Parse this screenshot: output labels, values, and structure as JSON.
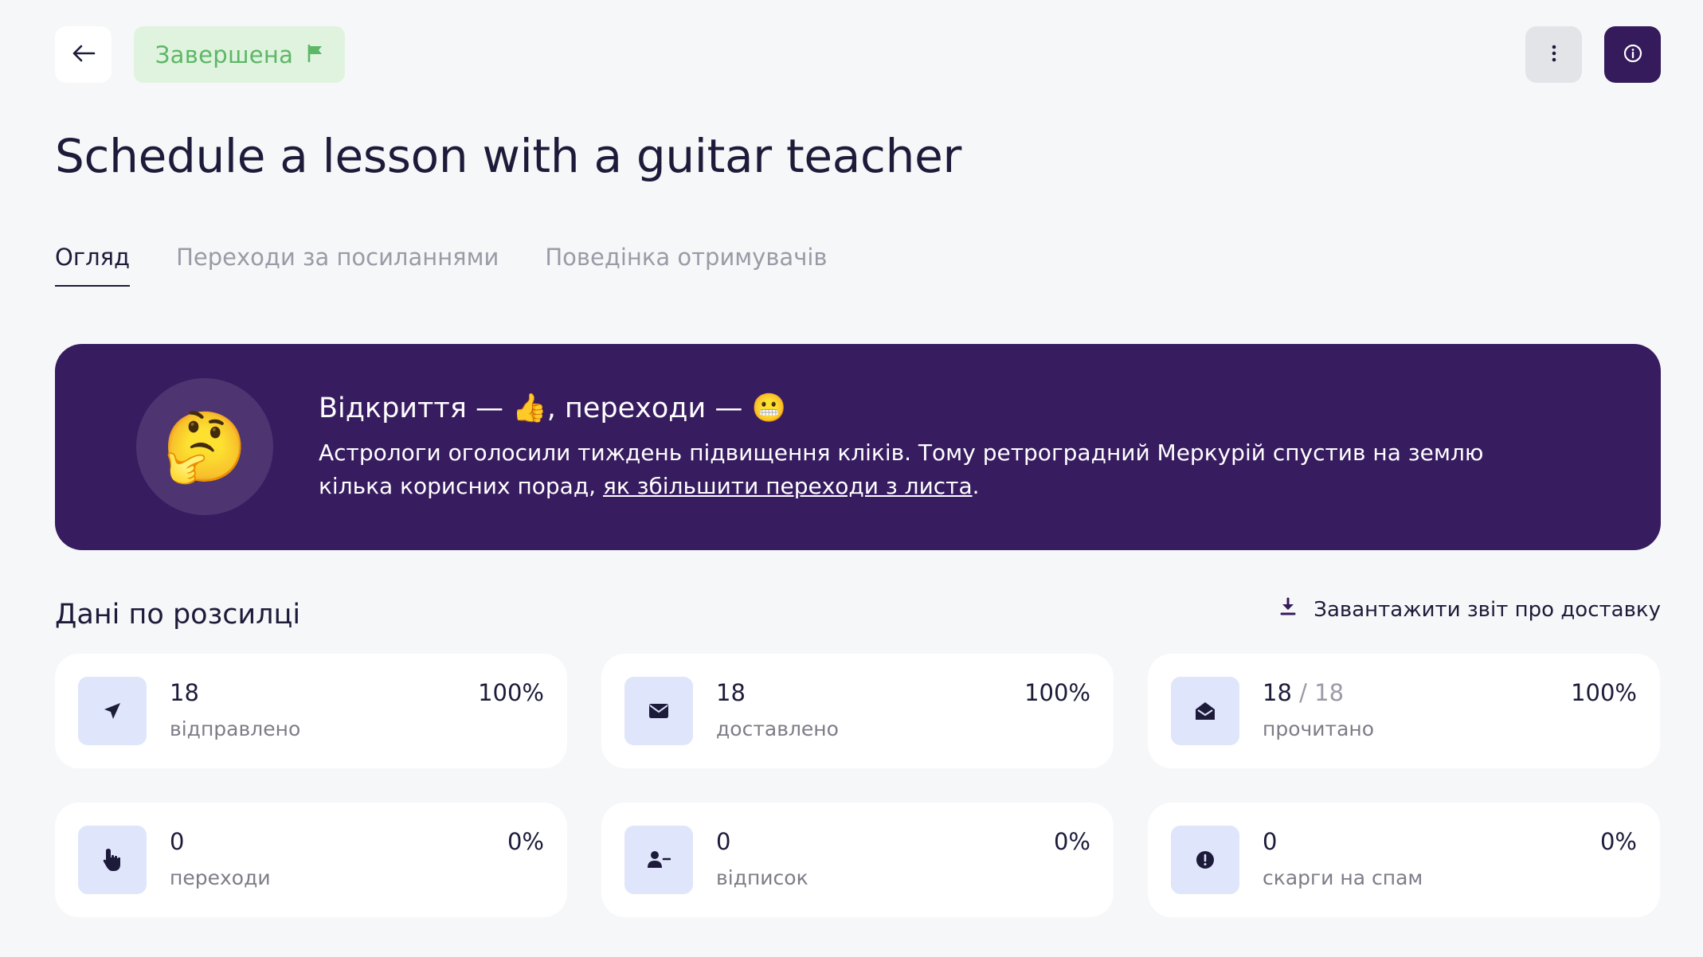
{
  "header": {
    "back_icon": "arrow-left-icon",
    "status_label": "Завершена",
    "status_icon": "flag-icon",
    "status_color": "#5db766",
    "more_icon": "vertical-dots-icon",
    "info_icon": "info-circle-icon",
    "accent_color": "#351a5c"
  },
  "page": {
    "title": "Schedule a lesson with a guitar teacher"
  },
  "tabs": [
    {
      "label": "Огляд",
      "active": true
    },
    {
      "label": "Переходи за посиланнями",
      "active": false
    },
    {
      "label": "Поведінка отримувачів",
      "active": false
    }
  ],
  "banner": {
    "emoji": "🤔",
    "headline": "Відкриття — 👍, переходи — 😬",
    "body_text": "Астрологи оголосили тиждень підвищення кліків. Тому ретроградний Меркурій спустив на землю кілька корисних порад, ",
    "link_text": "як збільшити переходи з листа",
    "body_end": "."
  },
  "section": {
    "title": "Дані по розсилці",
    "download_label": "Завантажити звіт про доставку",
    "download_icon": "download-icon"
  },
  "stats": [
    {
      "value": "18",
      "caption": "відправлено",
      "percent": "100%",
      "icon": "paper-plane-icon"
    },
    {
      "value": "18",
      "caption": "доставлено",
      "percent": "100%",
      "icon": "envelope-icon"
    },
    {
      "value": "18",
      "total": " / 18",
      "caption": "прочитано",
      "percent": "100%",
      "icon": "envelope-open-icon"
    },
    {
      "value": "0",
      "caption": "переходи",
      "percent": "0%",
      "icon": "pointer-hand-icon"
    },
    {
      "value": "0",
      "caption": "відписок",
      "percent": "0%",
      "icon": "user-minus-icon"
    },
    {
      "value": "0",
      "caption": "скарги на спам",
      "percent": "0%",
      "icon": "exclamation-circle-icon"
    }
  ]
}
